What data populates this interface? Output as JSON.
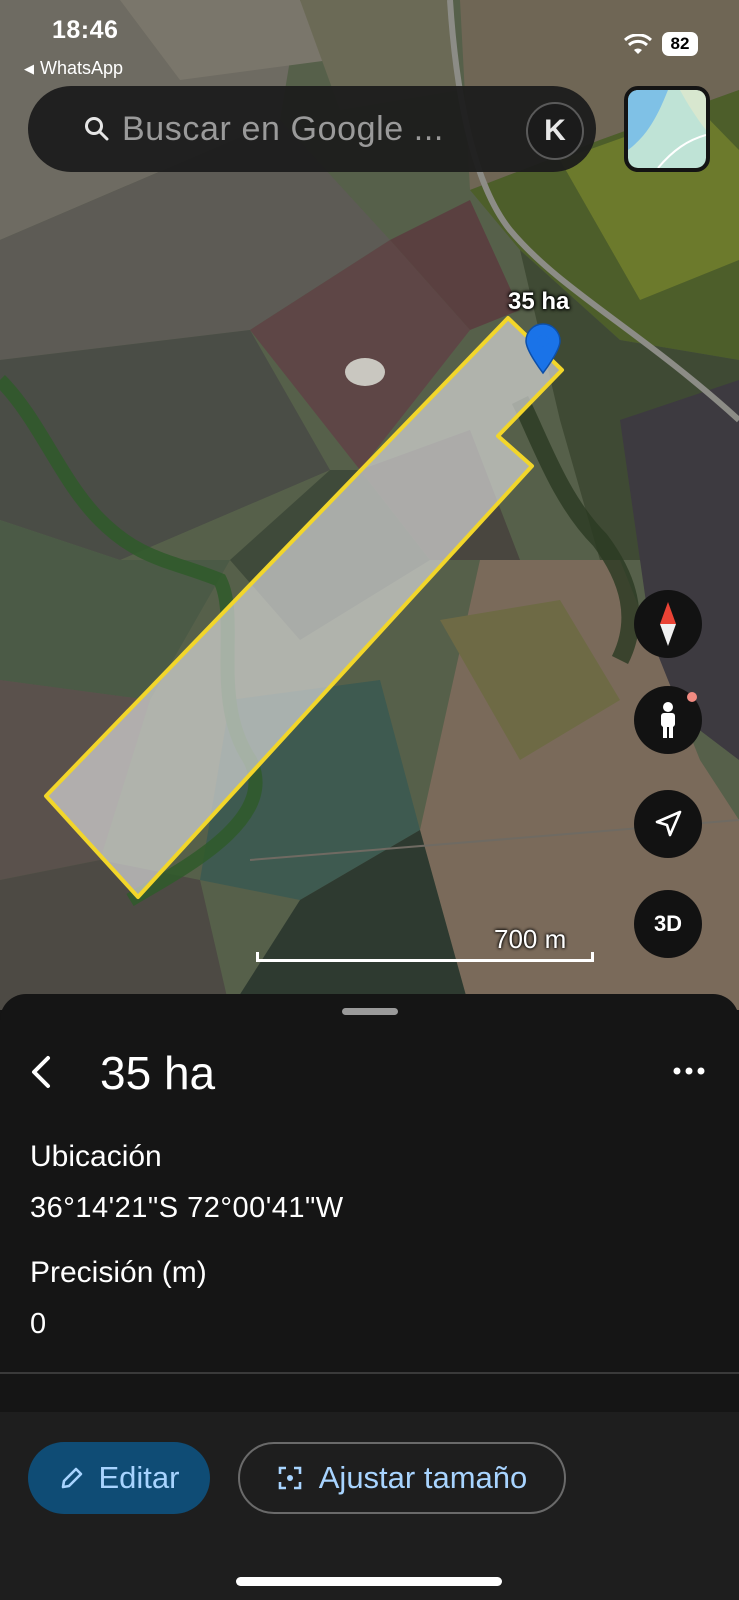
{
  "status_bar": {
    "time": "18:46",
    "back_app": "WhatsApp",
    "battery": "82"
  },
  "search": {
    "placeholder": "Buscar en Google ...",
    "avatar_letter": "K"
  },
  "map": {
    "polygon_label": "35 ha",
    "scale_label": "700 m",
    "button_3d": "3D",
    "polygon_stroke_color": "#f2d62a",
    "pin_color": "#1a73e8"
  },
  "sheet": {
    "title": "35 ha",
    "location_label": "Ubicación",
    "location_value": "36°14'21\"S 72°00'41\"W",
    "precision_label": "Precisión (m)",
    "precision_value": "0",
    "edit_label": "Editar",
    "resize_label": "Ajustar tamaño"
  },
  "icons": [
    "search-icon",
    "wifi-icon",
    "battery-icon",
    "layers-thumbnail",
    "map-pin-icon",
    "compass-icon",
    "pegman-icon",
    "locate-icon",
    "back-chevron-icon",
    "more-dots-icon",
    "pencil-icon",
    "resize-frame-icon"
  ]
}
